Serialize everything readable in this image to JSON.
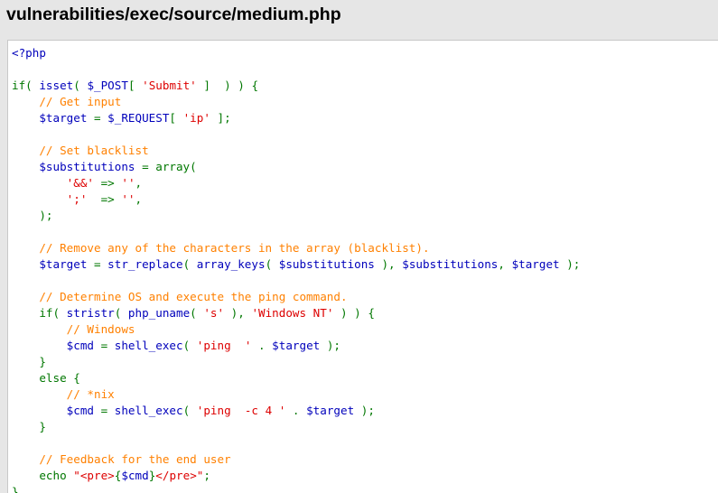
{
  "page": {
    "title": "vulnerabilities/exec/source/medium.php"
  },
  "colors": {
    "background": "#e6e6e6",
    "code_background": "#ffffff",
    "border": "#c8c8c8",
    "default": "#0000bb",
    "keyword": "#007700",
    "string": "#dd0000",
    "comment": "#ff8000"
  },
  "code": {
    "lines": [
      [
        {
          "t": "<?php",
          "c": "default"
        }
      ],
      [],
      [
        {
          "t": "if( ",
          "c": "keyword"
        },
        {
          "t": "isset",
          "c": "default"
        },
        {
          "t": "( ",
          "c": "keyword"
        },
        {
          "t": "$_POST",
          "c": "default"
        },
        {
          "t": "[ ",
          "c": "keyword"
        },
        {
          "t": "'Submit'",
          "c": "string"
        },
        {
          "t": " ]  ) ) {",
          "c": "keyword"
        }
      ],
      [
        {
          "t": "    ",
          "c": "default"
        },
        {
          "t": "// Get input",
          "c": "comment"
        }
      ],
      [
        {
          "t": "    $target",
          "c": "default"
        },
        {
          "t": " = ",
          "c": "keyword"
        },
        {
          "t": "$_REQUEST",
          "c": "default"
        },
        {
          "t": "[ ",
          "c": "keyword"
        },
        {
          "t": "'ip'",
          "c": "string"
        },
        {
          "t": " ];",
          "c": "keyword"
        }
      ],
      [],
      [
        {
          "t": "    ",
          "c": "default"
        },
        {
          "t": "// Set blacklist",
          "c": "comment"
        }
      ],
      [
        {
          "t": "    $substitutions",
          "c": "default"
        },
        {
          "t": " = array(",
          "c": "keyword"
        }
      ],
      [
        {
          "t": "        ",
          "c": "default"
        },
        {
          "t": "'&&'",
          "c": "string"
        },
        {
          "t": " => ",
          "c": "keyword"
        },
        {
          "t": "''",
          "c": "string"
        },
        {
          "t": ",",
          "c": "keyword"
        }
      ],
      [
        {
          "t": "        ",
          "c": "default"
        },
        {
          "t": "';'",
          "c": "string"
        },
        {
          "t": "  => ",
          "c": "keyword"
        },
        {
          "t": "''",
          "c": "string"
        },
        {
          "t": ",",
          "c": "keyword"
        }
      ],
      [
        {
          "t": "    );",
          "c": "keyword"
        }
      ],
      [],
      [
        {
          "t": "    ",
          "c": "default"
        },
        {
          "t": "// Remove any of the characters in the array (blacklist).",
          "c": "comment"
        }
      ],
      [
        {
          "t": "    $target",
          "c": "default"
        },
        {
          "t": " = ",
          "c": "keyword"
        },
        {
          "t": "str_replace",
          "c": "default"
        },
        {
          "t": "( ",
          "c": "keyword"
        },
        {
          "t": "array_keys",
          "c": "default"
        },
        {
          "t": "( ",
          "c": "keyword"
        },
        {
          "t": "$substitutions",
          "c": "default"
        },
        {
          "t": " ), ",
          "c": "keyword"
        },
        {
          "t": "$substitutions",
          "c": "default"
        },
        {
          "t": ", ",
          "c": "keyword"
        },
        {
          "t": "$target",
          "c": "default"
        },
        {
          "t": " );",
          "c": "keyword"
        }
      ],
      [],
      [
        {
          "t": "    ",
          "c": "default"
        },
        {
          "t": "// Determine OS and execute the ping command.",
          "c": "comment"
        }
      ],
      [
        {
          "t": "    if( ",
          "c": "keyword"
        },
        {
          "t": "stristr",
          "c": "default"
        },
        {
          "t": "( ",
          "c": "keyword"
        },
        {
          "t": "php_uname",
          "c": "default"
        },
        {
          "t": "( ",
          "c": "keyword"
        },
        {
          "t": "'s'",
          "c": "string"
        },
        {
          "t": " ), ",
          "c": "keyword"
        },
        {
          "t": "'Windows NT'",
          "c": "string"
        },
        {
          "t": " ) ) {",
          "c": "keyword"
        }
      ],
      [
        {
          "t": "        ",
          "c": "default"
        },
        {
          "t": "// Windows",
          "c": "comment"
        }
      ],
      [
        {
          "t": "        $cmd",
          "c": "default"
        },
        {
          "t": " = ",
          "c": "keyword"
        },
        {
          "t": "shell_exec",
          "c": "default"
        },
        {
          "t": "( ",
          "c": "keyword"
        },
        {
          "t": "'ping  '",
          "c": "string"
        },
        {
          "t": " . ",
          "c": "keyword"
        },
        {
          "t": "$target",
          "c": "default"
        },
        {
          "t": " );",
          "c": "keyword"
        }
      ],
      [
        {
          "t": "    }",
          "c": "keyword"
        }
      ],
      [
        {
          "t": "    else {",
          "c": "keyword"
        }
      ],
      [
        {
          "t": "        ",
          "c": "default"
        },
        {
          "t": "// *nix",
          "c": "comment"
        }
      ],
      [
        {
          "t": "        $cmd",
          "c": "default"
        },
        {
          "t": " = ",
          "c": "keyword"
        },
        {
          "t": "shell_exec",
          "c": "default"
        },
        {
          "t": "( ",
          "c": "keyword"
        },
        {
          "t": "'ping  -c 4 '",
          "c": "string"
        },
        {
          "t": " . ",
          "c": "keyword"
        },
        {
          "t": "$target",
          "c": "default"
        },
        {
          "t": " );",
          "c": "keyword"
        }
      ],
      [
        {
          "t": "    }",
          "c": "keyword"
        }
      ],
      [],
      [
        {
          "t": "    ",
          "c": "default"
        },
        {
          "t": "// Feedback for the end user",
          "c": "comment"
        }
      ],
      [
        {
          "t": "    ",
          "c": "default"
        },
        {
          "t": "echo ",
          "c": "keyword"
        },
        {
          "t": "\"<pre>",
          "c": "string"
        },
        {
          "t": "{",
          "c": "keyword"
        },
        {
          "t": "$cmd",
          "c": "default"
        },
        {
          "t": "}",
          "c": "keyword"
        },
        {
          "t": "</pre>\"",
          "c": "string"
        },
        {
          "t": ";",
          "c": "keyword"
        }
      ],
      [
        {
          "t": "}",
          "c": "keyword"
        }
      ]
    ]
  }
}
